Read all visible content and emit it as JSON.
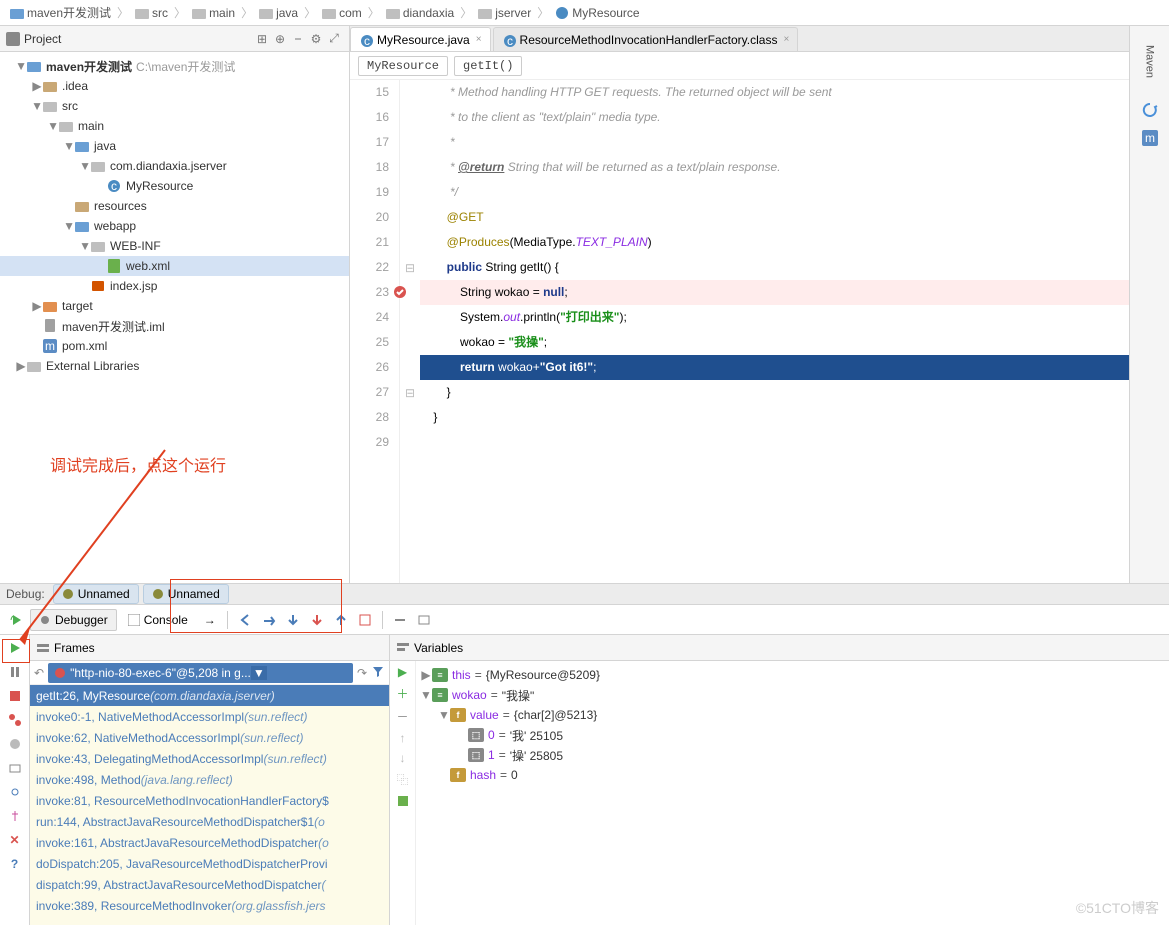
{
  "breadcrumb": [
    "maven开发测试",
    "src",
    "main",
    "java",
    "com",
    "diandaxia",
    "jserver",
    "MyResource"
  ],
  "project": {
    "title": "Project",
    "root": {
      "name": "maven开发测试",
      "path": "C:\\maven开发测试"
    },
    "tree": [
      {
        "d": 1,
        "arr": "▼",
        "ico": "folder-blue",
        "name": "maven开发测试",
        "path": " C:\\maven开发测试",
        "bold": true
      },
      {
        "d": 2,
        "arr": "▶",
        "ico": "folder-tan",
        "name": ".idea"
      },
      {
        "d": 2,
        "arr": "▼",
        "ico": "folder-gray",
        "name": "src"
      },
      {
        "d": 3,
        "arr": "▼",
        "ico": "folder-gray",
        "name": "main"
      },
      {
        "d": 4,
        "arr": "▼",
        "ico": "folder-blue",
        "name": "java"
      },
      {
        "d": 5,
        "arr": "▼",
        "ico": "folder-gray",
        "name": "com.diandaxia.jserver"
      },
      {
        "d": 6,
        "arr": "",
        "ico": "java-c",
        "name": "MyResource"
      },
      {
        "d": 4,
        "arr": "",
        "ico": "folder-tan",
        "name": "resources"
      },
      {
        "d": 4,
        "arr": "▼",
        "ico": "folder-blue",
        "name": "webapp"
      },
      {
        "d": 5,
        "arr": "▼",
        "ico": "folder-gray",
        "name": "WEB-INF"
      },
      {
        "d": 6,
        "arr": "",
        "ico": "xml",
        "name": "web.xml",
        "sel": true
      },
      {
        "d": 5,
        "arr": "",
        "ico": "jsp",
        "name": "index.jsp"
      },
      {
        "d": 2,
        "arr": "▶",
        "ico": "folder-orange",
        "name": "target"
      },
      {
        "d": 2,
        "arr": "",
        "ico": "file",
        "name": "maven开发测试.iml"
      },
      {
        "d": 2,
        "arr": "",
        "ico": "mvn",
        "name": "pom.xml"
      },
      {
        "d": 1,
        "arr": "▶",
        "ico": "folder-gray",
        "name": "External Libraries"
      }
    ]
  },
  "annotation_text": "调试完成后，点这个运行",
  "editor": {
    "tabs": [
      {
        "name": "MyResource.java",
        "active": true,
        "ico": "java-c"
      },
      {
        "name": "ResourceMethodInvocationHandlerFactory.class",
        "active": false,
        "ico": "java-c"
      }
    ],
    "crumbs": [
      "MyResource",
      "getIt()"
    ],
    "lines": [
      {
        "n": 15,
        "html": "         * Method handling HTTP GET requests. The returned object will be sent",
        "cls": "cmt",
        "cut": true
      },
      {
        "n": 16,
        "html": "         * to the client as \"text/plain\" media type.",
        "cls": "cmt"
      },
      {
        "n": 17,
        "html": "         *",
        "cls": "cmt"
      },
      {
        "n": 18,
        "html": "         * <span class='doc-tag'>@return</span> String that will be returned as a text/plain response.",
        "cls": "cmt"
      },
      {
        "n": 19,
        "html": "         */",
        "cls": "cmt"
      },
      {
        "n": 20,
        "html": "        <span class='anno'>@GET</span>"
      },
      {
        "n": 21,
        "html": "        <span class='anno'>@Produces</span>(MediaType.<span class='field'>TEXT_PLAIN</span>)"
      },
      {
        "n": 22,
        "html": "        <span class='kw'>public</span> String getIt() {"
      },
      {
        "n": 23,
        "html": "            String wokao = <span class='kw'>null</span>;",
        "err": true,
        "mark": "err"
      },
      {
        "n": 24,
        "html": "            System.<span class='field'>out</span>.println(<span class='str'>\"打印出来\"</span>);"
      },
      {
        "n": 25,
        "html": "            wokao = <span class='str'>\"我操\"</span>;"
      },
      {
        "n": 26,
        "html": "            <span class='kw'>return</span> wokao+<span class='str'>\"Got it6!\"</span>;",
        "hl": true
      },
      {
        "n": 27,
        "html": "        }"
      },
      {
        "n": 28,
        "html": "    }"
      },
      {
        "n": 29,
        "html": ""
      }
    ]
  },
  "right_label": "Maven",
  "debug": {
    "label": "Debug:",
    "tabs": [
      "Unnamed",
      "Unnamed"
    ],
    "sub_tabs": {
      "debugger": "Debugger",
      "console": "Console"
    },
    "frames_title": "Frames",
    "thread": "\"http-nio-80-exec-6\"@5,208 in g...",
    "frames": [
      {
        "t": "getIt:26, MyResource ",
        "p": "(com.diandaxia.jserver)",
        "sel": true
      },
      {
        "t": "invoke0:-1, NativeMethodAccessorImpl ",
        "p": "(sun.reflect)"
      },
      {
        "t": "invoke:62, NativeMethodAccessorImpl ",
        "p": "(sun.reflect)"
      },
      {
        "t": "invoke:43, DelegatingMethodAccessorImpl ",
        "p": "(sun.reflect)"
      },
      {
        "t": "invoke:498, Method ",
        "p": "(java.lang.reflect)"
      },
      {
        "t": "invoke:81, ResourceMethodInvocationHandlerFactory$",
        "p": ""
      },
      {
        "t": "run:144, AbstractJavaResourceMethodDispatcher$1 ",
        "p": "(o"
      },
      {
        "t": "invoke:161, AbstractJavaResourceMethodDispatcher ",
        "p": "(o"
      },
      {
        "t": "doDispatch:205, JavaResourceMethodDispatcherProvi",
        "p": ""
      },
      {
        "t": "dispatch:99, AbstractJavaResourceMethodDispatcher ",
        "p": "("
      },
      {
        "t": "invoke:389, ResourceMethodInvoker ",
        "p": "(org.glassfish.jers"
      }
    ],
    "vars_title": "Variables",
    "vars": [
      {
        "d": 0,
        "arr": "▶",
        "ico": "obj",
        "name": "this",
        "val": "{MyResource@5209}"
      },
      {
        "d": 0,
        "arr": "▼",
        "ico": "obj",
        "name": "wokao",
        "val": "\"我操\""
      },
      {
        "d": 1,
        "arr": "▼",
        "ico": "fld",
        "name": "value",
        "val": "{char[2]@5213}"
      },
      {
        "d": 2,
        "arr": "",
        "ico": "arr-i",
        "name": "0",
        "val": "'我' 25105"
      },
      {
        "d": 2,
        "arr": "",
        "ico": "arr-i",
        "name": "1",
        "val": "'操' 25805"
      },
      {
        "d": 1,
        "arr": "",
        "ico": "fld",
        "name": "hash",
        "val": "0"
      }
    ]
  },
  "watermark": "©51CTO博客"
}
